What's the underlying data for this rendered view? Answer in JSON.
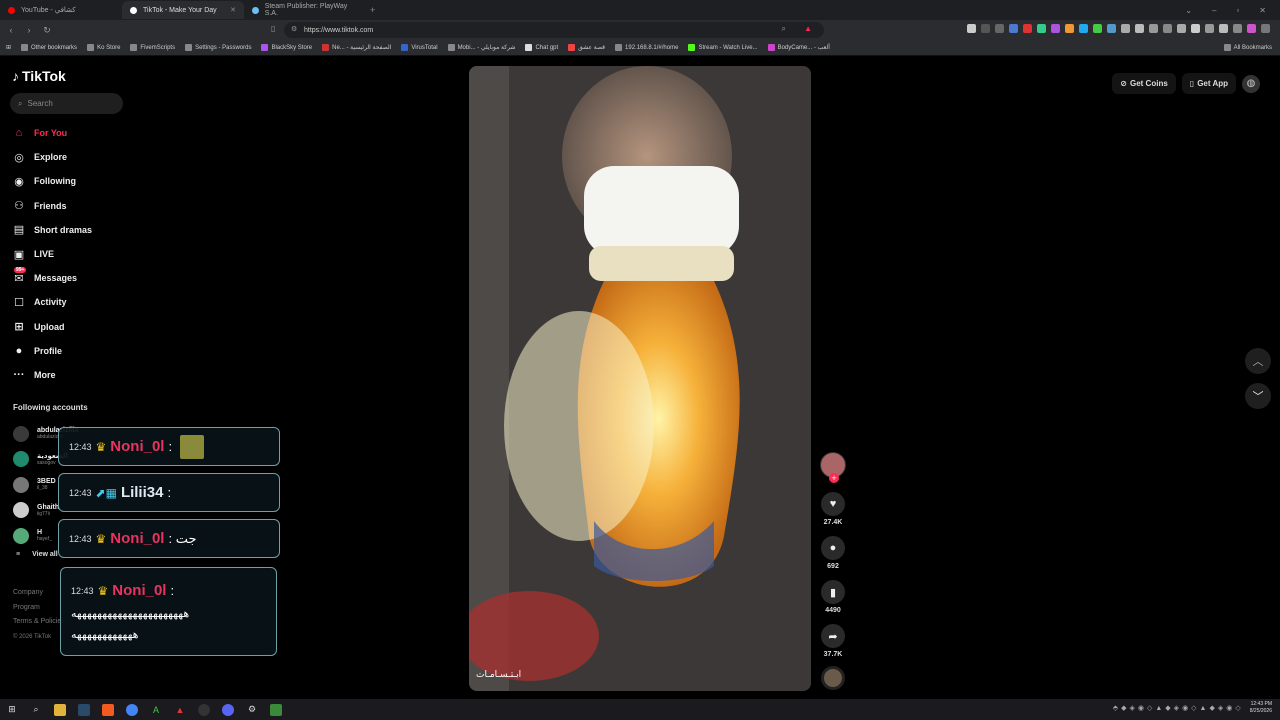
{
  "browser": {
    "tabs": [
      {
        "title": "YouTube - كشافي",
        "color": "#ff0000",
        "active": false
      },
      {
        "title": "TikTok - Make Your Day",
        "color": "#ffffff",
        "active": true
      },
      {
        "title": "Steam Publisher: PlayWay S.A.",
        "color": "#66c0f4",
        "active": false
      }
    ],
    "url": "https://www.tiktok.com",
    "bookmarks": [
      "Other bookmarks",
      "Ko Store",
      "FivemScripts",
      "Settings - Passwords",
      "BlackSky Store",
      "Ne... - الصفحة الرئيسية",
      "VirusTotal",
      "Mobi... - شركة موبايلي",
      "Chat gpt",
      "قصة عشق",
      "192.168.8.1/#/home",
      "Stream - Watch Live...",
      "BodyCame... - ألعب"
    ],
    "all_bookmarks": "All Bookmarks"
  },
  "sidebar": {
    "logo": "TikTok",
    "search_placeholder": "Search",
    "nav": [
      {
        "label": "For You",
        "icon": "home-icon",
        "glyph": "⌂",
        "active": true
      },
      {
        "label": "Explore",
        "icon": "compass-icon",
        "glyph": "◎",
        "active": false
      },
      {
        "label": "Following",
        "icon": "following-icon",
        "glyph": "◉",
        "active": false
      },
      {
        "label": "Friends",
        "icon": "friends-icon",
        "glyph": "⚇",
        "active": false
      },
      {
        "label": "Short dramas",
        "icon": "film-icon",
        "glyph": "▤",
        "active": false
      },
      {
        "label": "LIVE",
        "icon": "live-icon",
        "glyph": "▣",
        "active": false
      },
      {
        "label": "Messages",
        "icon": "messages-icon",
        "glyph": "✉",
        "active": false,
        "badge": "99+"
      },
      {
        "label": "Activity",
        "icon": "activity-icon",
        "glyph": "☐",
        "active": false
      },
      {
        "label": "Upload",
        "icon": "upload-icon",
        "glyph": "⊞",
        "active": false
      },
      {
        "label": "Profile",
        "icon": "profile-icon",
        "glyph": "●",
        "active": false
      },
      {
        "label": "More",
        "icon": "more-icon",
        "glyph": "···",
        "active": false
      }
    ],
    "following_title": "Following accounts",
    "accounts": [
      {
        "name": "abdulazizflix",
        "handle": "abdulazizflix"
      },
      {
        "name": "السعودية",
        "handle": "sasogov"
      },
      {
        "name": "3BED",
        "handle": "il_38"
      },
      {
        "name": "Ghaith",
        "handle": "iig77ii"
      },
      {
        "name": "H",
        "handle": "hayef_"
      }
    ],
    "view_all": "View all",
    "footer": [
      "Company",
      "Program",
      "Terms & Policies",
      "© 2026 TikTok"
    ]
  },
  "chat": [
    {
      "time": "12:43",
      "user": "Noni_0l",
      "user_color": "#e8345f",
      "msg": ":"
    },
    {
      "time": "12:43",
      "user": "Lilii34",
      "user_color": "#dfe8ee",
      "msg": ":"
    },
    {
      "time": "12:43",
      "user": "Noni_0l",
      "user_color": "#e8345f",
      "msg": ": جت"
    },
    {
      "time": "12:43",
      "user": "Noni_0l",
      "user_color": "#e8345f",
      "msg": ":",
      "line2": "ههههههههههههههههههههههه",
      "line3": "ههههههههههههه"
    }
  ],
  "video": {
    "caption": "ابـتـسـامـات",
    "likes": "27.4K",
    "comments": "692",
    "saves": "4490",
    "shares": "37.7K"
  },
  "top_actions": {
    "coins": "Get Coins",
    "app": "Get App"
  },
  "clock": {
    "time": "12:43 PM",
    "date": "8/25/2026"
  }
}
